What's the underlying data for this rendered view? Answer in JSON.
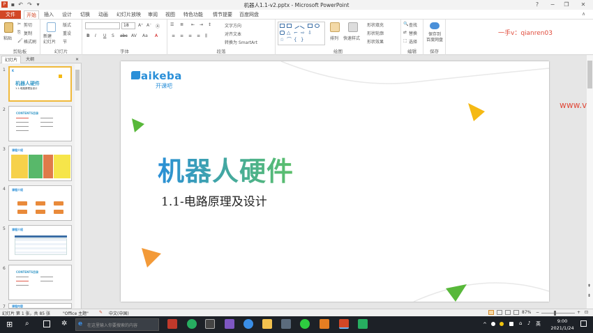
{
  "window": {
    "title": "机器人1.1-v2.pptx - Microsoft PowerPoint",
    "minimize": "−",
    "restore": "❐",
    "close": "✕"
  },
  "tabs": [
    "文件",
    "开始",
    "插入",
    "设计",
    "切换",
    "动画",
    "幻灯片放映",
    "审阅",
    "视图",
    "特色功能",
    "情节提要",
    "百度网盘"
  ],
  "ribbon": {
    "clipboard": {
      "paste": "粘贴",
      "cut": "剪切",
      "copy": "复制",
      "format_painter": "格式刷",
      "label": "剪贴板"
    },
    "slides": {
      "new_slide": "新建\n幻灯片",
      "layout": "版式",
      "reset": "重设",
      "section": "节",
      "label": "幻灯片"
    },
    "font": {
      "size": "18",
      "label": "字体"
    },
    "paragraph": {
      "text_direction": "文字方向",
      "align_text": "对齐文本",
      "smartart": "转换为 SmartArt",
      "label": "段落"
    },
    "drawing": {
      "arrange": "排列",
      "quick_styles": "快速样式",
      "shape_fill": "形状填充",
      "shape_outline": "形状轮廓",
      "shape_effects": "形状效果",
      "label": "绘图"
    },
    "editing": {
      "find": "查找",
      "replace": "替换",
      "select": "选择",
      "label": "编辑"
    },
    "save": {
      "save_to": "保存到\n百度网盘",
      "label": "保存"
    },
    "watermark": "一手v：qianren03"
  },
  "pane_tabs": {
    "slides": "幻灯片",
    "outline": "大纲",
    "close": "✕"
  },
  "thumbnails": [
    {
      "num": "1",
      "title": "机器人硬件",
      "subtitle": "1.1-电路原理及设计"
    },
    {
      "num": "2",
      "title": "CONTENTS目录"
    },
    {
      "num": "3",
      "title": "课程介绍"
    },
    {
      "num": "4",
      "title": "课程介绍"
    },
    {
      "num": "5",
      "title": "课程介绍"
    },
    {
      "num": "6",
      "title": "CONTENTS目录"
    },
    {
      "num": "7",
      "title": "课程内容"
    }
  ],
  "slide": {
    "logo": "aikeba",
    "logo_sub": "开课吧",
    "title": "机器人硬件",
    "subtitle": "1.1-电路原理及设计",
    "side_watermark": "www.v"
  },
  "status": {
    "slide_count": "幻灯片 第 1 张，共 85 张",
    "theme": "\"Office 主题\"",
    "language": "中文(中国)",
    "zoom": "87%"
  },
  "taskbar": {
    "search_placeholder": "在这里输入你要搜索的内容",
    "ime": "英",
    "time": "9:00",
    "date": "2021/1/24"
  },
  "colors": {
    "accent": "#d24726",
    "title_gradient_start": "#2a8fd8",
    "title_gradient_end": "#5cc06a"
  }
}
